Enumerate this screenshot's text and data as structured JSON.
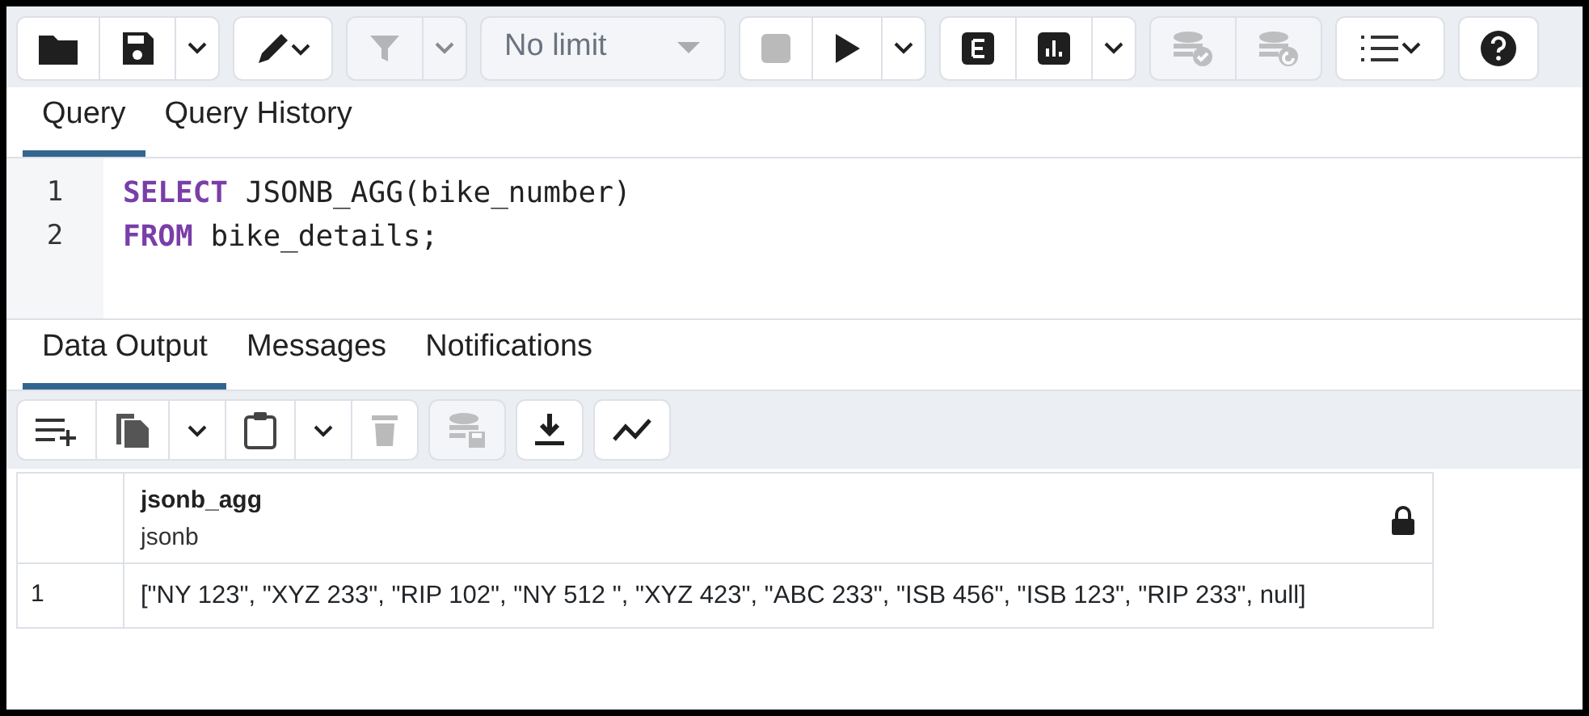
{
  "toolbar": [
    [
      {
        "kind": "folder",
        "disabled": false
      },
      {
        "kind": "save",
        "disabled": false
      },
      {
        "kind": "caret",
        "disabled": false
      }
    ],
    [
      {
        "kind": "pencil",
        "disabled": false
      }
    ],
    [
      {
        "kind": "filter",
        "disabled": true
      },
      {
        "kind": "caret",
        "disabled": true
      }
    ],
    [
      {
        "kind": "select",
        "label": "No limit",
        "disabled": true
      }
    ],
    [
      {
        "kind": "stop",
        "disabled": true
      },
      {
        "kind": "play",
        "disabled": false
      },
      {
        "kind": "caret",
        "disabled": false
      }
    ],
    [
      {
        "kind": "explain",
        "disabled": false
      },
      {
        "kind": "analyze",
        "disabled": false
      },
      {
        "kind": "caret",
        "disabled": false
      }
    ],
    [
      {
        "kind": "commit",
        "disabled": true
      },
      {
        "kind": "rollback",
        "disabled": true
      }
    ],
    [
      {
        "kind": "macros",
        "disabled": false
      }
    ],
    [
      {
        "kind": "help",
        "disabled": false
      }
    ]
  ],
  "editor_tabs": [
    {
      "label": "Query",
      "selected": true
    },
    {
      "label": "Query History",
      "selected": false
    }
  ],
  "editor_lines": [
    {
      "number": "1",
      "tokens": [
        {
          "text": "SELECT",
          "kind": "keyword"
        },
        {
          "text": " JSONB_AGG(bike_number)",
          "kind": "plain"
        }
      ]
    },
    {
      "number": "2",
      "tokens": [
        {
          "text": "FROM",
          "kind": "keyword"
        },
        {
          "text": " bike_details;",
          "kind": "plain"
        }
      ]
    }
  ],
  "output_tabs": [
    {
      "label": "Data Output",
      "selected": true
    },
    {
      "label": "Messages",
      "selected": false
    },
    {
      "label": "Notifications",
      "selected": false
    }
  ],
  "output_toolbar": [
    [
      {
        "kind": "addrow",
        "disabled": false
      },
      {
        "kind": "copy",
        "disabled": false
      },
      {
        "kind": "caret",
        "disabled": false
      },
      {
        "kind": "paste",
        "disabled": false
      },
      {
        "kind": "caret",
        "disabled": false
      },
      {
        "kind": "delete",
        "disabled": true
      }
    ],
    [
      {
        "kind": "savedata",
        "disabled": true
      }
    ],
    [
      {
        "kind": "download",
        "disabled": false
      }
    ],
    [
      {
        "kind": "graph",
        "disabled": false
      }
    ]
  ],
  "table": {
    "columns": [
      {
        "name": "jsonb_agg",
        "type": "jsonb",
        "locked": true
      }
    ],
    "rows": [
      {
        "number": "1",
        "cells": [
          "[\"NY 123\", \"XYZ 233\", \"RIP 102\", \"NY 512 \", \"XYZ 423\", \"ABC 233\", \"ISB 456\", \"ISB 123\", \"RIP 233\", null]"
        ]
      }
    ]
  }
}
